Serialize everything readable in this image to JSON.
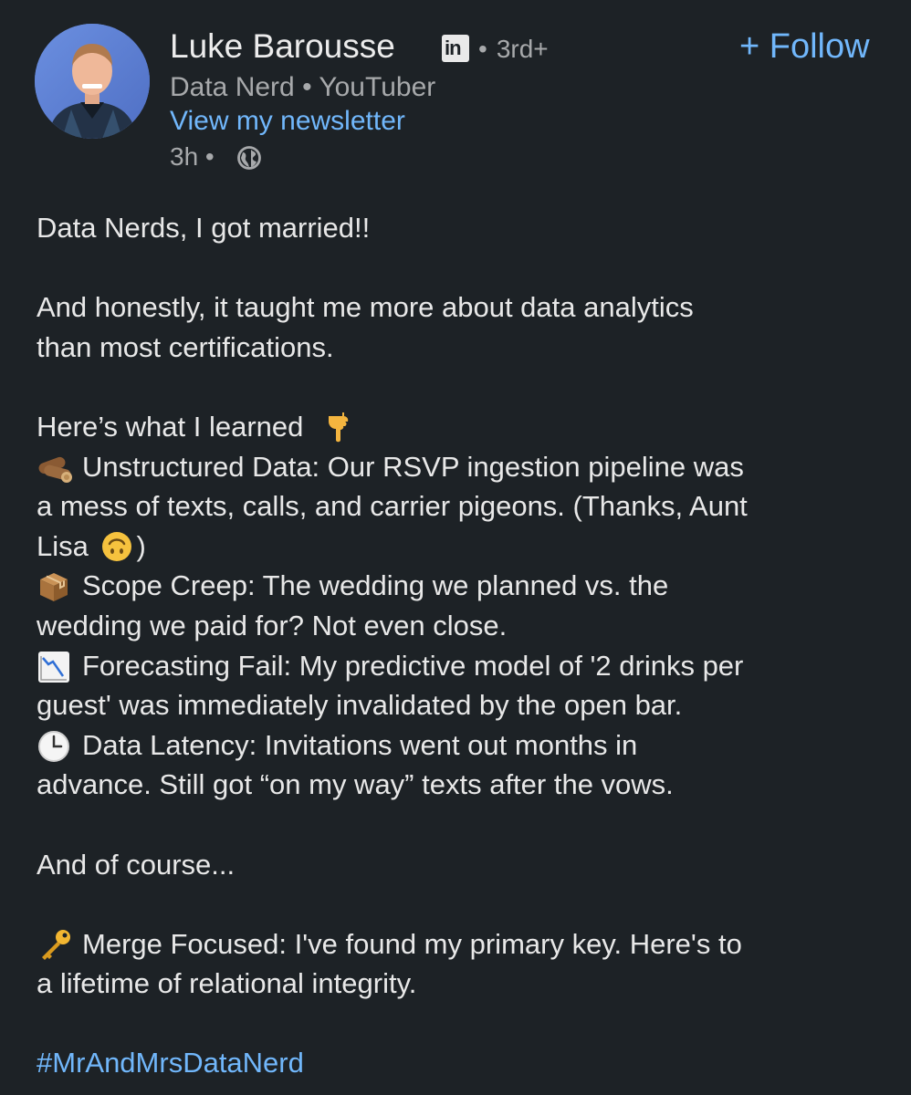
{
  "author": {
    "name": "Luke Barousse",
    "linkedin_badge": "in",
    "degree": "3rd+",
    "headline": "Data Nerd • YouTuber",
    "newsletter_link": "View my newsletter",
    "timestamp": "3h",
    "visibility_icon": "globe-icon"
  },
  "follow_label": "+ Follow",
  "post": {
    "intro": "Data Nerds, I got married!!",
    "para1_line1": "And honestly, it taught me more about data analytics",
    "para1_line2": "than most certifications.",
    "learned": "Here’s what I learned",
    "item1_line1": "Unstructured Data: Our RSVP ingestion pipeline was",
    "item1_line2": "a mess of texts, calls, and carrier pigeons. (Thanks, Aunt",
    "item1_line3a": "Lisa",
    "item1_line3b": ")",
    "item2_line1": "Scope Creep: The wedding we planned vs. the",
    "item2_line2": "wedding we paid for? Not even close.",
    "item3_line1": "Forecasting Fail: My predictive model of '2 drinks per",
    "item3_line2": "guest' was immediately invalidated by the open bar.",
    "item4_line1": "Data Latency: Invitations went out months in",
    "item4_line2": "advance. Still got “on my way” texts after the vows.",
    "and_course": "And of course...",
    "key_line1": "Merge Focused: I've found my primary key. Here's to",
    "key_line2": "a lifetime of relational integrity.",
    "hashtag": "#MrAndMrsDataNerd"
  },
  "colors": {
    "background": "#1d2226",
    "link": "#71b7fb",
    "text": "#e8e8e8",
    "muted": "#a7a9ab"
  }
}
